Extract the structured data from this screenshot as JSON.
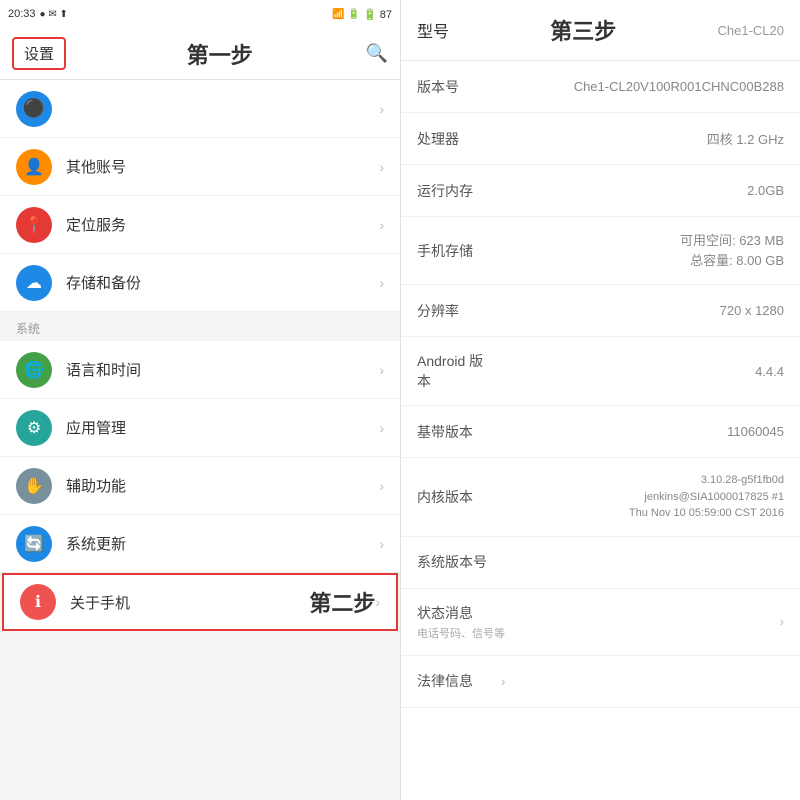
{
  "statusBar": {
    "time": "20:33",
    "icons": "● ✉ ▲",
    "rightIcons": "🔋 87"
  },
  "leftPanel": {
    "settingsLabel": "设置",
    "stepOne": "第一步",
    "sectionSystem": "系统",
    "menuItems": [
      {
        "id": "other-account",
        "label": "其他账号",
        "iconColor": "#FF8C00",
        "iconChar": "👤"
      },
      {
        "id": "location",
        "label": "定位服务",
        "iconColor": "#e53935",
        "iconChar": "📍"
      },
      {
        "id": "storage",
        "label": "存储和备份",
        "iconColor": "#1e88e5",
        "iconChar": "☁"
      },
      {
        "id": "language",
        "label": "语言和时间",
        "iconColor": "#43a047",
        "iconChar": "🌐"
      },
      {
        "id": "app-manage",
        "label": "应用管理",
        "iconColor": "#26a69a",
        "iconChar": "⚙"
      },
      {
        "id": "accessibility",
        "label": "辅助功能",
        "iconColor": "#78909c",
        "iconChar": "✋"
      },
      {
        "id": "system-update",
        "label": "系统更新",
        "iconColor": "#1e88e5",
        "iconChar": "🔄"
      },
      {
        "id": "about-phone",
        "label": "关于手机",
        "iconColor": "#ef5350",
        "iconChar": "ℹ"
      }
    ],
    "stepTwo": "第二步",
    "chevron": "›"
  },
  "rightPanel": {
    "stepThree": "第三步",
    "modelLabel": "型号",
    "modelValue": "Che1-CL20",
    "rows": [
      {
        "id": "version-num",
        "label": "版本号",
        "value": "Che1-CL20V100R001CHNC00B288",
        "hasChevron": false
      },
      {
        "id": "processor",
        "label": "处理器",
        "value": "四核 1.2 GHz",
        "hasChevron": false
      },
      {
        "id": "ram",
        "label": "运行内存",
        "value": "2.0GB",
        "hasChevron": false
      },
      {
        "id": "storage",
        "label": "手机存储",
        "value": "可用空间: 623 MB\n总容量: 8.00 GB",
        "hasChevron": false
      },
      {
        "id": "resolution",
        "label": "分辨率",
        "value": "720 x 1280",
        "hasChevron": false
      },
      {
        "id": "android-ver",
        "label": "Android 版本",
        "value": "4.4.4",
        "hasChevron": false
      },
      {
        "id": "baseband",
        "label": "基带版本",
        "value": "11060045",
        "hasChevron": false
      },
      {
        "id": "kernel",
        "label": "内核版本",
        "value": "3.10.28-g5f1fb0d\njenkins@SIA1000017825 #1\nThu Nov 10 05:59:00 CST 2016",
        "hasChevron": false
      },
      {
        "id": "system-ver",
        "label": "系统版本号",
        "value": "",
        "hasChevron": false
      },
      {
        "id": "status-info",
        "label": "状态消息",
        "sublabel": "电话号码、信号等",
        "value": "",
        "hasChevron": true
      },
      {
        "id": "legal-info",
        "label": "法律信息",
        "value": "",
        "hasChevron": true
      }
    ]
  }
}
